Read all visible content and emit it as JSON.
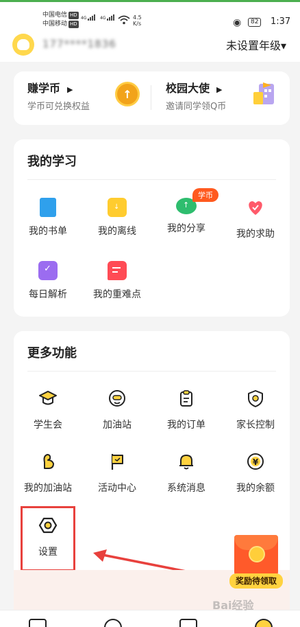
{
  "status_bar": {
    "carrier1": "中国电信",
    "carrier2": "中国移动",
    "hd": "HD",
    "net": "4G",
    "speed_value": "4.5",
    "speed_unit": "K/s",
    "battery": "82",
    "time": "1:37"
  },
  "header": {
    "username_blurred": "177****1836",
    "grade_label": "未设置年级",
    "grade_arrow": "▾"
  },
  "earn": {
    "left_title": "赚学币",
    "left_sub": "学币可兑换权益",
    "right_title": "校园大使",
    "right_sub": "邀请同学领Q币",
    "arrow": "▶"
  },
  "study": {
    "title": "我的学习",
    "badge": "学币",
    "items": [
      {
        "label": "我的书单"
      },
      {
        "label": "我的离线"
      },
      {
        "label": "我的分享"
      },
      {
        "label": "我的求助"
      },
      {
        "label": "每日解析"
      },
      {
        "label": "我的重难点"
      }
    ]
  },
  "more": {
    "title": "更多功能",
    "items": [
      {
        "label": "学生会"
      },
      {
        "label": "加油站"
      },
      {
        "label": "我的订单"
      },
      {
        "label": "家长控制"
      },
      {
        "label": "我的加油站"
      },
      {
        "label": "活动中心"
      },
      {
        "label": "系统消息"
      },
      {
        "label": "我的余额"
      },
      {
        "label": "设置"
      }
    ]
  },
  "reward": {
    "label": "奖励待领取"
  },
  "watermark": "Bai经验",
  "colors": {
    "accent_yellow": "#ffd23f",
    "highlight_red": "#e8413d",
    "badge_orange": "#ff5a1f"
  }
}
